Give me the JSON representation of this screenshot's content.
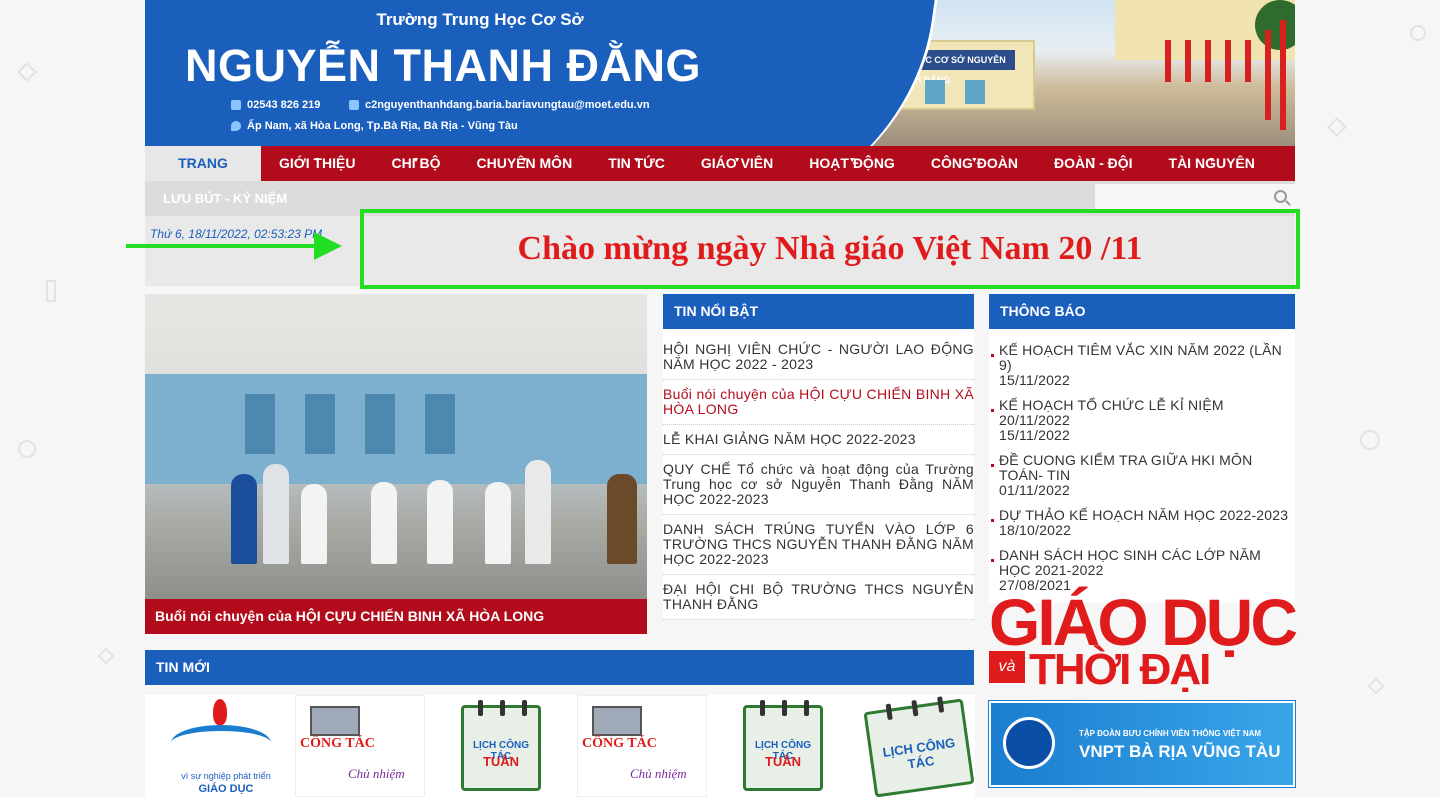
{
  "header": {
    "school_sub": "Trường Trung Học Cơ Sở",
    "school_name": "NGUYỄN THANH ĐẰNG",
    "phone": "02543 826 219",
    "email": "c2nguyenthanhdang.baria.bariavungtau@moet.edu.vn",
    "address": "Ấp Nam, xã Hòa Long, Tp.Bà Rịa, Bà Rịa - Vũng Tàu",
    "photo_sign": "TRƯỜNG TRUNG HỌC CƠ SỞ NGUYỄN THANH ĐẰNG"
  },
  "nav": {
    "items": [
      {
        "label": "TRANG CHỦ"
      },
      {
        "label": "GIỚI THIỆU"
      },
      {
        "label": "CHI BỘ"
      },
      {
        "label": "CHUYÊN MÔN"
      },
      {
        "label": "TIN TỨC"
      },
      {
        "label": "GIÁO VIÊN"
      },
      {
        "label": "HOẠT ĐỘNG"
      },
      {
        "label": "CÔNG ĐOÀN"
      },
      {
        "label": "ĐOÀN - ĐỘI"
      },
      {
        "label": "TÀI NGUYÊN"
      }
    ],
    "sub_item": "LƯU BÚT - KỶ NIỆM"
  },
  "date": "Thứ 6, 18/11/2022, 02:53:23 PM",
  "banner": "Chào mừng ngày Nhà giáo Việt Nam 20 /11",
  "feature": {
    "caption": "Buổi nói chuyện của HỘI CỰU CHIẾN BINH XÃ HÒA LONG"
  },
  "featured_news": {
    "title": "TIN NỔI BẬT",
    "items": [
      {
        "text": "HỘI NGHỊ VIÊN CHỨC - NGƯỜI LAO ĐỘNG NĂM HỌC 2022 - 2023"
      },
      {
        "text": "Buổi nói chuyện của HỘI CỰU CHIẾN BINH XÃ HÒA LONG"
      },
      {
        "text": "LỄ KHAI GIẢNG NĂM HỌC 2022-2023"
      },
      {
        "text": "QUY CHẾ Tổ chức và hoạt động của Trường Trung học cơ sở Nguyễn Thanh Đằng NĂM HỌC 2022-2023"
      },
      {
        "text": "DANH SÁCH TRÚNG TUYỂN VÀO LỚP 6 TRƯỜNG THCS NGUYỄN THANH ĐẰNG NĂM HỌC 2022-2023"
      },
      {
        "text": "ĐẠI HỘI CHI BỘ TRƯỜNG THCS NGUYỄN THANH ĐẰNG"
      }
    ]
  },
  "notices": {
    "title": "THÔNG BÁO",
    "items": [
      {
        "text": "KẾ HOẠCH TIÊM VẮC XIN NĂM 2022 (LẦN 9)",
        "date": "15/11/2022"
      },
      {
        "text": "KẾ HOẠCH TỔ CHỨC LỄ KỈ NIỆM 20/11/2022",
        "date": "15/11/2022"
      },
      {
        "text": "ĐỀ CUONG KIỂM TRA GIỮA HKI MÔN TOÁN- TIN",
        "date": "01/11/2022"
      },
      {
        "text": "DỰ THẢO KẾ HOẠCH NĂM HỌC 2022-2023",
        "date": "18/10/2022"
      },
      {
        "text": "DANH SÁCH HỌC SINH CÁC LỚP NĂM HỌC 2021-2022",
        "date": "27/08/2021"
      }
    ]
  },
  "ads": {
    "gd_big": "GIÁO DỤC",
    "gd_va": "và",
    "gd_small": "THỜI ĐẠI",
    "vnpt_small": "TẬP ĐOÀN BƯU CHÍNH VIỄN THÔNG VIỆT NAM",
    "vnpt_big": "VNPT BÀ RỊA VŨNG TÀU"
  },
  "latest": {
    "title": "TIN MỚI",
    "emblem_caption1": "vì sự nghiệp phát triển",
    "emblem_caption2": "GIÁO DỤC",
    "cong_tac": "CÔNG TÁC",
    "chu_nhiem": "Chủ nhiệm",
    "lich_cong_tac": "LỊCH CÔNG TÁC",
    "tuan": "TUẦN"
  },
  "colors": {
    "brand_blue": "#1b5fbd",
    "nav_red": "#b20c1c",
    "highlight_green": "#22dd22",
    "banner_red": "#e01b1b"
  }
}
